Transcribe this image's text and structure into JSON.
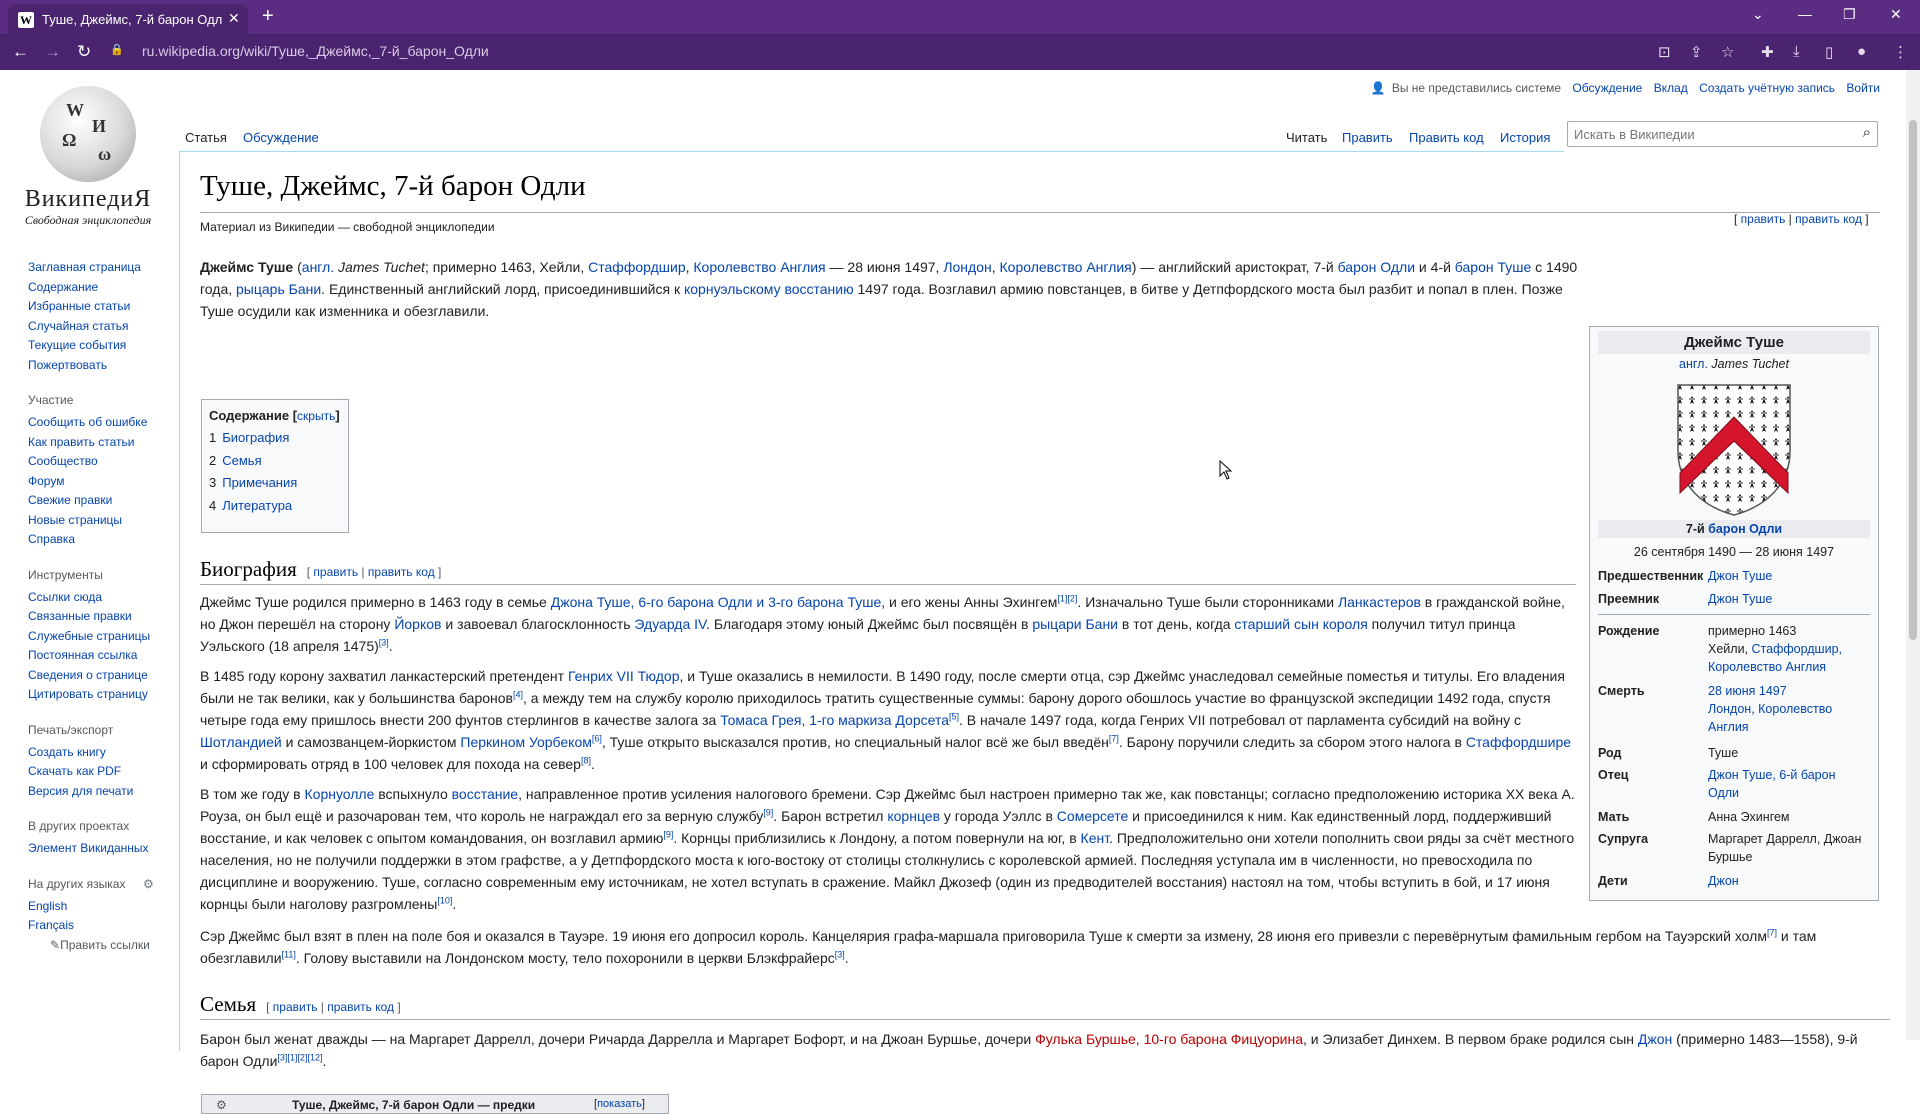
{
  "browser": {
    "tab_title": "Туше, Джеймс, 7-й барон Одли",
    "tab_favicon": "W",
    "url_host": "ru.wikipedia.org",
    "url_path": "/wiki/Туше,_Джеймс,_7-й_барон_Одли"
  },
  "logo": {
    "wordmark": "ВикипедиЯ",
    "tagline": "Свободная энциклопедия"
  },
  "sidebar": {
    "main": [
      "Заглавная страница",
      "Содержание",
      "Избранные статьи",
      "Случайная статья",
      "Текущие события",
      "Пожертвовать"
    ],
    "participation_heading": "Участие",
    "participation": [
      "Сообщить об ошибке",
      "Как править статьи",
      "Сообщество",
      "Форум",
      "Свежие правки",
      "Новые страницы",
      "Справка"
    ],
    "tools_heading": "Инструменты",
    "tools": [
      "Ссылки сюда",
      "Связанные правки",
      "Служебные страницы",
      "Постоянная ссылка",
      "Сведения о странице",
      "Цитировать страницу"
    ],
    "print_heading": "Печать/экспорт",
    "print": [
      "Создать книгу",
      "Скачать как PDF",
      "Версия для печати"
    ],
    "projects_heading": "В других проектах",
    "projects": [
      "Элемент Викиданных"
    ],
    "langs_heading": "На других языках",
    "langs": [
      "English",
      "Français"
    ],
    "edit_links": "Править ссылки"
  },
  "usernav": {
    "not_logged": "Вы не представились системе",
    "talk": "Обсуждение",
    "contribs": "Вклад",
    "create": "Создать учётную запись",
    "login": "Войти"
  },
  "tabs": {
    "article": "Статья",
    "talk": "Обсуждение",
    "read": "Читать",
    "edit": "Править",
    "edit_source": "Править код",
    "history": "История"
  },
  "search": {
    "placeholder": "Искать в Википедии"
  },
  "article": {
    "title": "Туше, Джеймс, 7-й барон Одли",
    "from": "Материал из Википедии — свободной энциклопедии",
    "edit": "править",
    "edit_code": "править код"
  },
  "toc": {
    "heading": "Содержание",
    "hide": "скрыть",
    "items": [
      {
        "n": "1",
        "t": "Биография"
      },
      {
        "n": "2",
        "t": "Семья"
      },
      {
        "n": "3",
        "t": "Примечания"
      },
      {
        "n": "4",
        "t": "Литература"
      }
    ]
  },
  "sections": {
    "bio": "Биография",
    "family": "Семья"
  },
  "infobox": {
    "name": "Джеймс Туше",
    "orig_lang": "англ.",
    "orig_name": "James Tuchet",
    "title_prefix": "7-й",
    "title_link": "барон Одли",
    "dates": "26 сентября 1490 — 28 июня 1497",
    "predecessor_k": "Предшественник",
    "predecessor_v": "Джон Туше",
    "successor_k": "Преемник",
    "successor_v": "Джон Туше",
    "birth_k": "Рождение",
    "birth_v1": "примерно 1463",
    "birth_v2": "Хейли,",
    "birth_v3": "Стаффордшир,",
    "birth_v4": "Королевство Англия",
    "death_k": "Смерть",
    "death_v1": "28 июня 1497",
    "death_v2": "Лондон, Королевство",
    "death_v3": "Англия",
    "house_k": "Род",
    "house_v": "Туше",
    "father_k": "Отец",
    "father_v1": "Джон Туше, 6-й барон",
    "father_v2": "Одли",
    "mother_k": "Мать",
    "mother_v": "Анна Эхингем",
    "spouse_k": "Супруга",
    "spouse_v1": "Маргарет Даррелл, Джоан",
    "spouse_v2": "Буршье",
    "children_k": "Дети",
    "children_v": "Джон"
  },
  "navbox": {
    "title": "Туше, Джеймс, 7-й барон Одли — предки",
    "show": "показать"
  }
}
